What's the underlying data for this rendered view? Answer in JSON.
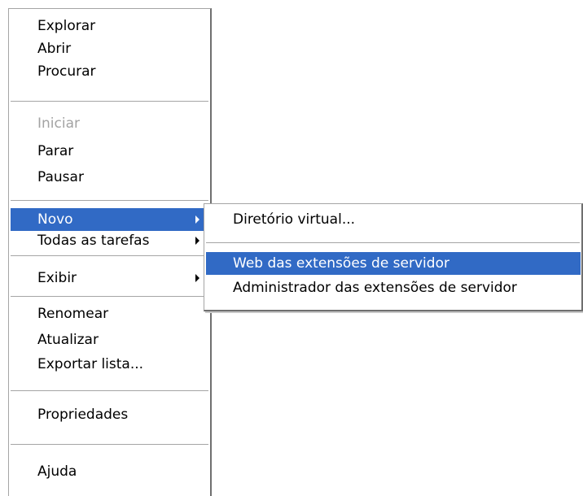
{
  "main_menu": {
    "items": [
      {
        "label": "Explorar"
      },
      {
        "label": "Abrir"
      },
      {
        "label": "Procurar"
      },
      {
        "label": "Iniciar",
        "state": "disabled"
      },
      {
        "label": "Parar"
      },
      {
        "label": "Pausar"
      },
      {
        "label": "Novo",
        "state": "highlighted",
        "has_submenu": true
      },
      {
        "label": "Todas as tarefas",
        "has_submenu": true
      },
      {
        "label": "Exibir",
        "has_submenu": true
      },
      {
        "label": "Renomear"
      },
      {
        "label": "Atualizar"
      },
      {
        "label": "Exportar lista..."
      },
      {
        "label": "Propriedades"
      },
      {
        "label": "Ajuda"
      }
    ]
  },
  "submenu": {
    "items": [
      {
        "label": "Diretório virtual..."
      },
      {
        "label": "Web das extensões de servidor",
        "state": "highlighted"
      },
      {
        "label": "Administrador das extensões de servidor"
      }
    ]
  },
  "colors": {
    "highlight_bg": "#316ac5",
    "highlight_text": "#ffffff",
    "disabled_text": "#a3a3a3",
    "separator": "#a5a5a5"
  },
  "icons": {
    "submenu_indicator": "submenu-arrow-icon"
  }
}
